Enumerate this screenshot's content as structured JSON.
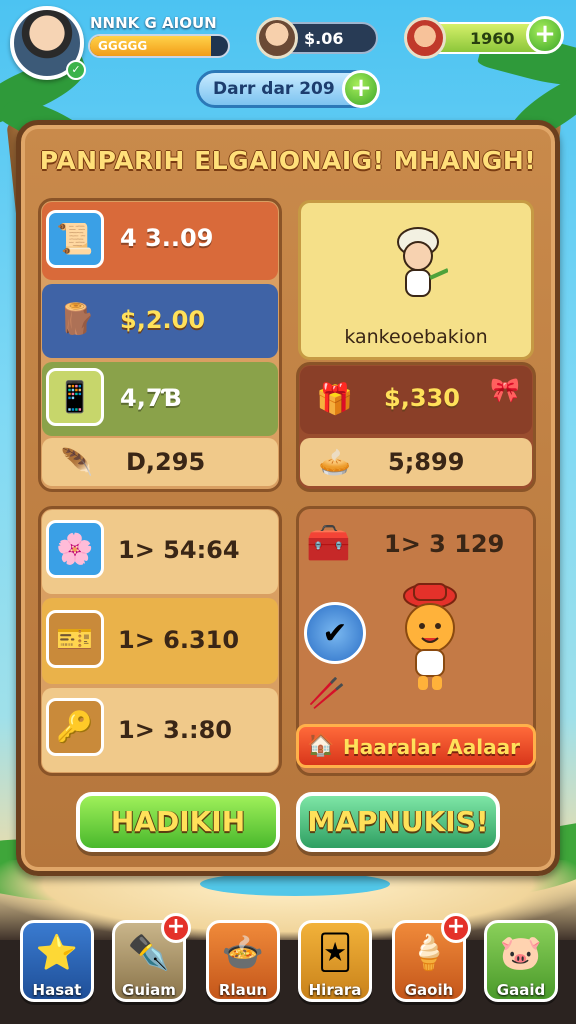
{
  "header": {
    "player_name": "NNNK G AIOUN",
    "xp_text": "GGGGG",
    "xp_fraction": 0.88,
    "resource_1_value": "$.06",
    "resource_2_value": "1960",
    "date_label": "Darr dar 209"
  },
  "board": {
    "title": "PANPARIH ELGAIONAIG! MHANGH!",
    "left_top": [
      {
        "icon": "scroll-icon",
        "value": "4 3..09"
      },
      {
        "icon": "log-icon",
        "value": "$,2.00"
      },
      {
        "icon": "phone-icon",
        "value": "4,7Ɓ"
      },
      {
        "icon": "feather-icon",
        "value": "D,295"
      }
    ],
    "character": {
      "name": "kankeoebakion"
    },
    "right_top": [
      {
        "icon": "gift-box-icon",
        "value": "$,330"
      },
      {
        "icon": "pie-icon",
        "value": "5;899"
      }
    ],
    "left_bottom": [
      {
        "icon": "flower-icon",
        "value": "1> 54:64"
      },
      {
        "icon": "ticket-icon",
        "value": "1> 6.310"
      },
      {
        "icon": "key-icon",
        "value": "1> 3.:80"
      }
    ],
    "right_bottom": {
      "value": "1> 3 129"
    },
    "orange_button_label": "Haaralar Aalaar",
    "left_button_label": "HADIKIH",
    "right_button_label": "MAPNUKIS!"
  },
  "nav": {
    "items": [
      {
        "icon": "star-icon",
        "label": "Hasat"
      },
      {
        "icon": "pen-icon",
        "label": "Guiam",
        "badge": "+"
      },
      {
        "icon": "bowl-icon",
        "label": "Rlaun"
      },
      {
        "icon": "card-icon",
        "label": "Hirara"
      },
      {
        "icon": "icecream-icon",
        "label": "Gaoih",
        "badge": "+"
      },
      {
        "icon": "pig-icon",
        "label": "Gaaid"
      }
    ]
  },
  "colors": {
    "board_wood": "#c98a4b",
    "title_gold": "#ffe07a",
    "button_green": "#49b82c",
    "button_orange": "#d8361b",
    "badge_red": "#e4312a"
  }
}
